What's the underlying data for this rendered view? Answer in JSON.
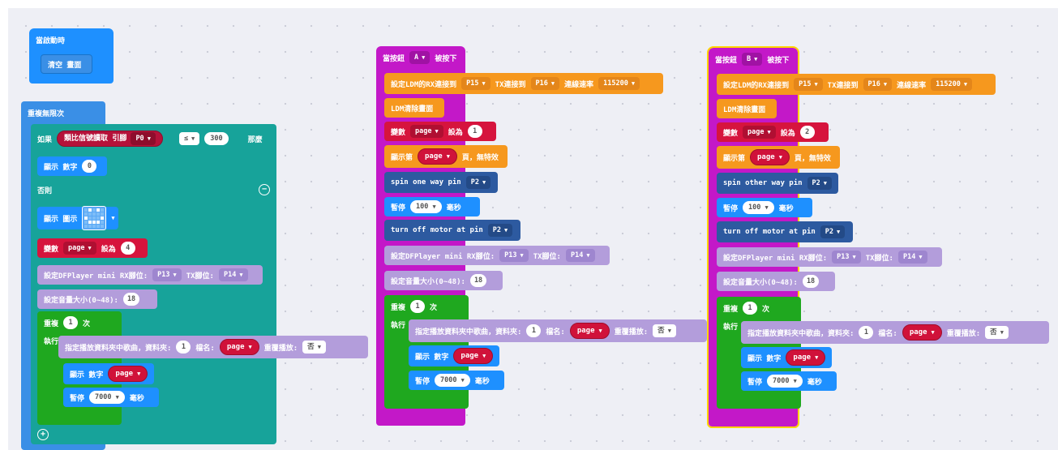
{
  "colors": {
    "basic": "#1e90ff",
    "logic": "#17a39a",
    "variables": "#d6143d",
    "music": "#b39ddb",
    "loops": "#1fa81f",
    "ldm": "#f6981e",
    "input": "#c318c8",
    "motor": "#2d5aa0",
    "selected": "#ffd400"
  },
  "stack1": {
    "hat_label": "當啟動時",
    "clear_label": "清空 畫面"
  },
  "stack2": {
    "forever_label": "重複無限次",
    "if_label": "如果",
    "analog_read_label": "類比信號讀取 引腳",
    "analog_pin": "P0",
    "compare_op": "≤",
    "threshold": "300",
    "then_label": "那麼",
    "show_number_label": "顯示 數字",
    "show_number_value": "0",
    "else_label": "否則",
    "show_icon_label": "顯示 圖示",
    "set_label": "變數",
    "var_name": "page",
    "to_label": "設為",
    "set_value": "4",
    "dfp_label": "設定DFPlayer mini RX腳位:",
    "dfp_rx": "P13",
    "dfp_tx_label": "TX腳位:",
    "dfp_tx": "P14",
    "volume_label": "設定音量大小(0~48):",
    "volume_value": "18",
    "repeat_label": "重複",
    "repeat_times": "1",
    "times_label": "次",
    "do_label": "執行",
    "play_label": "指定播放資料夾中歌曲，資料夾:",
    "folder_value": "1",
    "file_label": "檔名:",
    "loop_label": "重覆播放:",
    "loop_value": "否",
    "show_num2_label": "顯示 數字",
    "pause_label": "暫停",
    "pause_value": "7000",
    "ms_label": "毫秒"
  },
  "stack3": {
    "hat_label": "當按鈕",
    "button": "A",
    "pressed_label": "被按下",
    "ldm_label": "設定LDM的RX連接到",
    "ldm_rx": "P15",
    "ldm_tx_label": "TX連接到",
    "ldm_tx": "P16",
    "baud_label": "連線速率",
    "baud": "115200",
    "ldm_clear_label": "LDM清除畫面",
    "set_label": "變數",
    "var_name": "page",
    "to_label": "設為",
    "set_value": "1",
    "show_page_label": "顯示第",
    "page_suffix": "頁，無特效",
    "spin_label": "spin one way pin",
    "spin_pin": "P2",
    "pause_label": "暫停",
    "pause_value": "100",
    "ms_label": "毫秒",
    "motor_off_label": "turn off motor at pin",
    "motor_pin": "P2",
    "dfp_label": "設定DFPlayer mini RX腳位:",
    "dfp_rx": "P13",
    "dfp_tx_label": "TX腳位:",
    "dfp_tx": "P14",
    "volume_label": "設定音量大小(0~48):",
    "volume_value": "18",
    "repeat_label": "重複",
    "repeat_times": "1",
    "times_label": "次",
    "do_label": "執行",
    "play_label": "指定播放資料夾中歌曲，資料夾:",
    "folder_value": "1",
    "file_label": "檔名:",
    "loop_label": "重覆播放:",
    "loop_value": "否",
    "show_num_label": "顯示 數字",
    "pause2_value": "7000"
  },
  "stack4": {
    "hat_label": "當按鈕",
    "button": "B",
    "pressed_label": "被按下",
    "ldm_label": "設定LDM的RX連接到",
    "ldm_rx": "P15",
    "ldm_tx_label": "TX連接到",
    "ldm_tx": "P16",
    "baud_label": "連線速率",
    "baud": "115200",
    "ldm_clear_label": "LDM清除畫面",
    "set_label": "變數",
    "var_name": "page",
    "to_label": "設為",
    "set_value": "2",
    "show_page_label": "顯示第",
    "page_suffix": "頁，無特效",
    "spin_label": "spin other way pin",
    "spin_pin": "P2",
    "pause_label": "暫停",
    "pause_value": "100",
    "ms_label": "毫秒",
    "motor_off_label": "turn off motor at pin",
    "motor_pin": "P2",
    "dfp_label": "設定DFPlayer mini RX腳位:",
    "dfp_rx": "P13",
    "dfp_tx_label": "TX腳位:",
    "dfp_tx": "P14",
    "volume_label": "設定音量大小(0~48):",
    "volume_value": "18",
    "repeat_label": "重複",
    "repeat_times": "1",
    "times_label": "次",
    "do_label": "執行",
    "play_label": "指定播放資料夾中歌曲，資料夾:",
    "folder_value": "1",
    "file_label": "檔名:",
    "loop_label": "重覆播放:",
    "loop_value": "否",
    "show_num_label": "顯示 數字",
    "pause2_value": "7000"
  }
}
